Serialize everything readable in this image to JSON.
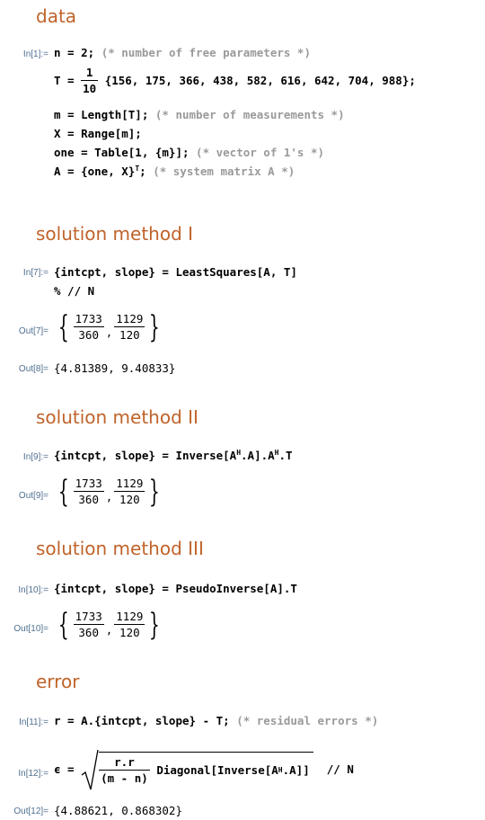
{
  "sections": {
    "data": "data",
    "method1": "solution method I",
    "method2": "solution method II",
    "method3": "solution method III",
    "error": "error"
  },
  "cells": {
    "in1": {
      "label": "In[1]:=",
      "l1_code": "n = 2; ",
      "l1_comment": "(* number of free parameters *)",
      "t_lhs": "T = ",
      "t_num": "1",
      "t_den": "10",
      "t_list": " {156, 175, 366, 438, 582, 616, 642, 704, 988};",
      "m_code": "m = Length[T]; ",
      "m_comment": "(* number of measurements *)",
      "x_code": "X = Range[m];",
      "one_code": "one = Table[1, {m}]; ",
      "one_comment": "(* vector of 1's *)",
      "a_code_pre": "A = {one, X}",
      "a_sup": "T",
      "a_code_post": "; ",
      "a_comment": "(* system matrix A *)"
    },
    "in7": {
      "label": "In[7]:=",
      "line1": "{intcpt, slope} = LeastSquares[A, T]",
      "line2": "% // N"
    },
    "out7": {
      "label": "Out[7]=",
      "f1_num": "1733",
      "f1_den": "360",
      "f2_num": "1129",
      "f2_den": "120"
    },
    "out8": {
      "label": "Out[8]=",
      "value": "{4.81389, 9.40833}"
    },
    "in9": {
      "label": "In[9]:=",
      "pre": "{intcpt, slope} = Inverse[A",
      "sup1": "H",
      "mid": ".A].A",
      "sup2": "H",
      "post": ".T"
    },
    "out9": {
      "label": "Out[9]=",
      "f1_num": "1733",
      "f1_den": "360",
      "f2_num": "1129",
      "f2_den": "120"
    },
    "in10": {
      "label": "In[10]:=",
      "code": "{intcpt, slope} = PseudoInverse[A].T"
    },
    "out10": {
      "label": "Out[10]=",
      "f1_num": "1733",
      "f1_den": "360",
      "f2_num": "1129",
      "f2_den": "120"
    },
    "in11": {
      "label": "In[11]:=",
      "code": "r = A.{intcpt, slope} - T; ",
      "comment": "(* residual errors *)"
    },
    "in12": {
      "label": "In[12]:=",
      "lhs": "ϵ = ",
      "num": "r.r",
      "den": "(m - n)",
      "body_pre": " Diagonal[Inverse[A",
      "sup": "H",
      "body_post": ".A]]",
      "tail": "  // N"
    },
    "out12": {
      "label": "Out[12]=",
      "value": "{4.88621, 0.868302}"
    }
  }
}
